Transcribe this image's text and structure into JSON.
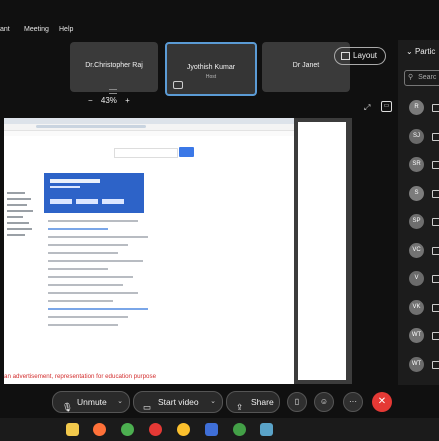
{
  "menu": {
    "items": [
      "ant",
      "Meeting",
      "Help"
    ]
  },
  "tiles": [
    {
      "name": "Dr.Christopher Raj",
      "role": ""
    },
    {
      "name": "Jyothish Kumar",
      "role": "Host"
    },
    {
      "name": "Dr Janet",
      "role": ""
    }
  ],
  "layout": {
    "label": "Layout"
  },
  "zoom": {
    "minus": "−",
    "level": "43%",
    "plus": "+"
  },
  "shared": {
    "warning": "an advertisement, representation for education purpose"
  },
  "participants": {
    "header": "Partic",
    "search_placeholder": "Searc",
    "avatars": [
      {
        "initials": "R",
        "color": "#7a7a7a"
      },
      {
        "initials": "SJ",
        "color": "#6a6a6a"
      },
      {
        "initials": "SR",
        "color": "#717171"
      },
      {
        "initials": "S",
        "color": "#7c7c7c"
      },
      {
        "initials": "SP",
        "color": "#6e6e6e"
      },
      {
        "initials": "VC",
        "color": "#737373"
      },
      {
        "initials": "V",
        "color": "#6b6b6b"
      },
      {
        "initials": "VK",
        "color": "#707070"
      },
      {
        "initials": "WT",
        "color": "#747474"
      },
      {
        "initials": "WT",
        "color": "#6c6c6c"
      }
    ]
  },
  "controls": {
    "unmute": "Unmute",
    "start_video": "Start video",
    "share": "Share",
    "more": "···",
    "end": "✕"
  },
  "colors": {
    "accent": "#5b9bd5",
    "end": "#e53935",
    "warning": "#d32f2f"
  },
  "taskbar_icons": [
    "files-icon",
    "firefox-icon",
    "chrome-icon",
    "opera-icon",
    "chrome-icon",
    "app-icon",
    "chrome-icon",
    "webex-icon"
  ]
}
